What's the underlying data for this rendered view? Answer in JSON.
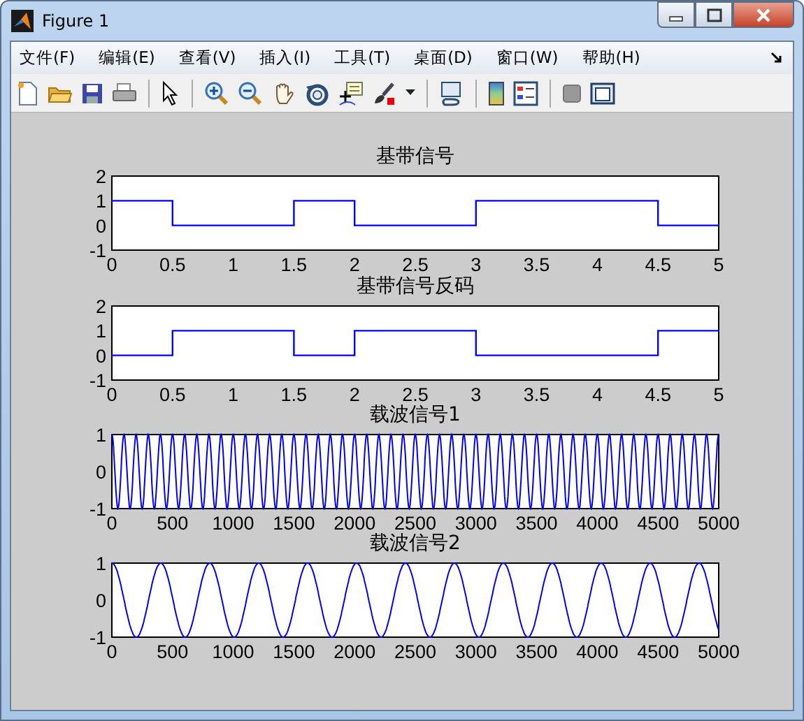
{
  "window": {
    "title": "Figure 1"
  },
  "menu": [
    {
      "label": "文件(F)"
    },
    {
      "label": "编辑(E)"
    },
    {
      "label": "查看(V)"
    },
    {
      "label": "插入(I)"
    },
    {
      "label": "工具(T)"
    },
    {
      "label": "桌面(D)"
    },
    {
      "label": "窗口(W)"
    },
    {
      "label": "帮助(H)"
    }
  ],
  "subplots": [
    {
      "kind": "chart",
      "chart_data": {
        "type": "line",
        "title": "基带信号",
        "x": [
          0,
          0.5,
          0.5,
          1.5,
          1.5,
          2,
          2,
          3,
          3,
          4.5,
          4.5,
          5
        ],
        "series": [
          {
            "color": "#0000ff",
            "values": [
              1,
              1,
              0,
              0,
              1,
              1,
              0,
              0,
              1,
              1,
              0,
              0
            ]
          }
        ],
        "xlim": [
          0,
          5
        ],
        "ylim": [
          -1,
          2
        ],
        "xticks": [
          0,
          0.5,
          1,
          1.5,
          2,
          2.5,
          3,
          3.5,
          4,
          4.5,
          5
        ],
        "yticks": [
          -1,
          0,
          1,
          2
        ]
      }
    },
    {
      "kind": "chart",
      "chart_data": {
        "type": "line",
        "title": "基带信号反码",
        "x": [
          0,
          0.5,
          0.5,
          1.5,
          1.5,
          2,
          2,
          3,
          3,
          4.5,
          4.5,
          5
        ],
        "series": [
          {
            "color": "#0000ff",
            "values": [
              0,
              0,
              1,
              1,
              0,
              0,
              1,
              1,
              0,
              0,
              1,
              1
            ]
          }
        ],
        "xlim": [
          0,
          5
        ],
        "ylim": [
          -1,
          2
        ],
        "xticks": [
          0,
          0.5,
          1,
          1.5,
          2,
          2.5,
          3,
          3.5,
          4,
          4.5,
          5
        ],
        "yticks": [
          -1,
          0,
          1,
          2
        ]
      }
    },
    {
      "kind": "waveform",
      "title": "载波信号1",
      "xticks": [
        "0",
        "500",
        "1000",
        "1500",
        "2000",
        "2500",
        "3000",
        "3500",
        "4000",
        "4500",
        "5000"
      ],
      "yticks": [
        "1",
        "0",
        "-1"
      ]
    },
    {
      "kind": "waveform",
      "title": "载波信号2",
      "xticks": [
        "0",
        "500",
        "1000",
        "1500",
        "2000",
        "2500",
        "3000",
        "3500",
        "4000",
        "4500",
        "5000"
      ],
      "yticks": [
        "1",
        "0",
        "-1"
      ]
    }
  ]
}
